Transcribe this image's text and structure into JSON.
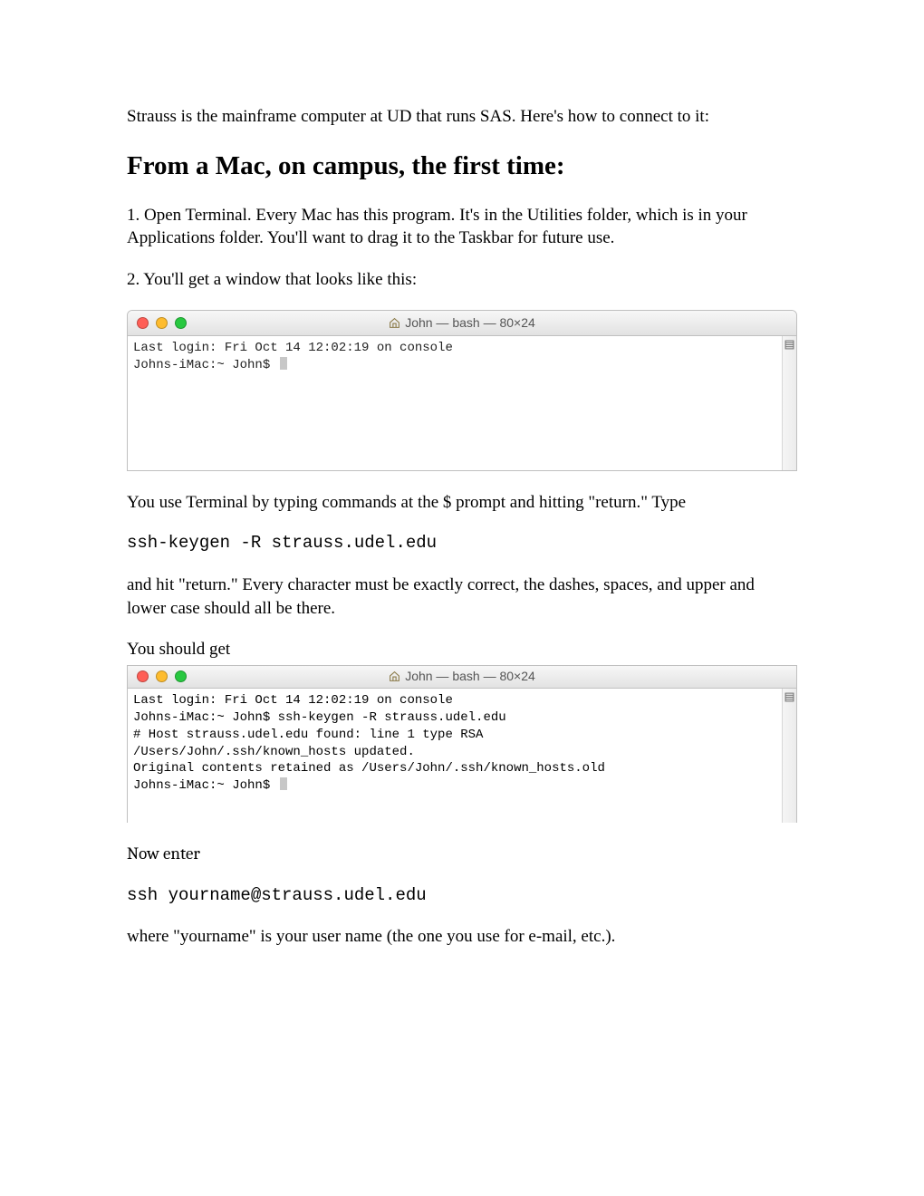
{
  "intro": "Strauss is the mainframe computer at UD that runs SAS. Here's how to connect to it:",
  "heading": "From a Mac, on campus, the first time:",
  "step1": "1. Open Terminal. Every Mac has this program. It's in the Utilities folder, which is in your Applications folder. You'll want to drag it to the Taskbar for future use.",
  "step2": "2. You'll get a window that looks like this:",
  "terminal1": {
    "title": "John — bash — 80×24",
    "lines": "Last login: Fri Oct 14 12:02:19 on console\nJohns-iMac:~ John$ "
  },
  "afterTerm1a": "You use Terminal by typing commands at the $ prompt and hitting \"return.\" Type",
  "cmd1": "ssh-keygen -R strauss.udel.edu",
  "afterCmd1": "and hit \"return.\" Every character must be exactly correct, the dashes, spaces, and upper and lower case should all be there.",
  "youShouldGet": "You should get",
  "terminal2": {
    "title": "John — bash — 80×24",
    "lines": "Last login: Fri Oct 14 12:02:19 on console\nJohns-iMac:~ John$ ssh-keygen -R strauss.udel.edu\n# Host strauss.udel.edu found: line 1 type RSA\n/Users/John/.ssh/known_hosts updated.\nOriginal contents retained as /Users/John/.ssh/known_hosts.old\nJohns-iMac:~ John$ "
  },
  "nowEnter": "Now enter",
  "cmd2": "ssh yourname@strauss.udel.edu",
  "afterCmd2": "where \"yourname\" is your user name (the one you use for e-mail, etc.)."
}
